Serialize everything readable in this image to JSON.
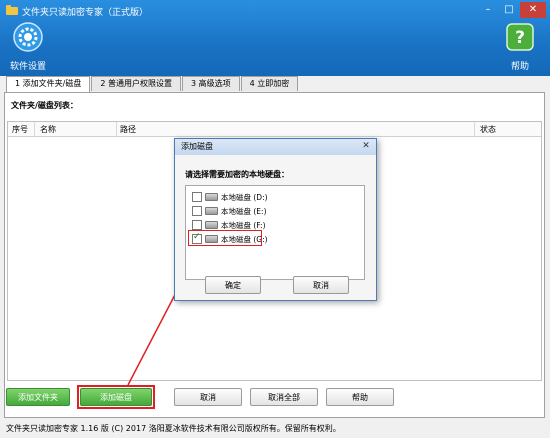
{
  "window": {
    "title": "文件夹只读加密专家（正式版）",
    "controls": {
      "minimize": "–",
      "maximize": "□",
      "close": "✕"
    }
  },
  "toolbar": {
    "settings_label": "软件设置",
    "help_label": "帮助",
    "settings_icon": "gear-icon",
    "help_icon": "question-icon"
  },
  "tabs": [
    {
      "label": "1 添加文件夹/磁盘",
      "active": true
    },
    {
      "label": "2 普通用户权限设置",
      "active": false
    },
    {
      "label": "3 高级选项",
      "active": false
    },
    {
      "label": "4 立即加密",
      "active": false
    }
  ],
  "list": {
    "label": "文件夹/磁盘列表：",
    "columns": [
      "序号",
      "名称",
      "路径",
      "状态"
    ]
  },
  "buttons": {
    "add_folder": "添加文件夹",
    "add_disk": "添加磁盘",
    "cancel": "取消",
    "cancel_all": "取消全部",
    "help": "帮助"
  },
  "status_bar": "文件夹只读加密专家 1.16 版  (C) 2017 洛阳夏冰软件技术有限公司版权所有。保留所有权利。",
  "dialog": {
    "title": "添加磁盘",
    "close": "✕",
    "prompt": "请选择需要加密的本地硬盘：",
    "disks": [
      {
        "label": "本地磁盘 (D:)",
        "checked": false
      },
      {
        "label": "本地磁盘 (E:)",
        "checked": false
      },
      {
        "label": "本地磁盘 (F:)",
        "checked": false
      },
      {
        "label": "本地磁盘 (G:)",
        "checked": true
      }
    ],
    "ok": "确定",
    "cancel": "取消"
  },
  "colors": {
    "title_bar": "#1a72c4",
    "highlight": "#e02020",
    "green_button": "#45a93a"
  }
}
